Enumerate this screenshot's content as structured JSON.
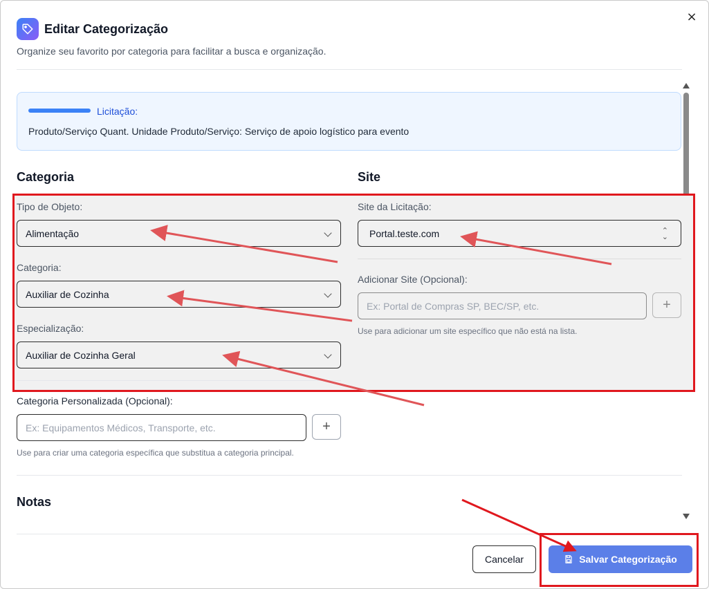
{
  "dialog": {
    "title": "Editar Categorização",
    "subtitle": "Organize seu favorito por categoria para facilitar a busca e organização.",
    "close_glyph": "×"
  },
  "info": {
    "label": "Licitação:",
    "text": "Produto/Serviço Quant. Unidade Produto/Serviço: Serviço de apoio logístico para evento"
  },
  "categoria": {
    "heading": "Categoria",
    "tipo_label": "Tipo de Objeto:",
    "tipo_value": "Alimentação",
    "categoria_label": "Categoria:",
    "categoria_value": "Auxiliar de Cozinha",
    "especializacao_label": "Especialização:",
    "especializacao_value": "Auxiliar de Cozinha Geral",
    "personalizada_label": "Categoria Personalizada (Opcional):",
    "personalizada_placeholder": "Ex: Equipamentos Médicos, Transporte, etc.",
    "personalizada_hint": "Use para criar uma categoria específica que substitua a categoria principal.",
    "plus_glyph": "+"
  },
  "site": {
    "heading": "Site",
    "site_label": "Site da Licitação:",
    "site_value": "Portal.teste.com",
    "adicionar_label": "Adicionar Site (Opcional):",
    "adicionar_placeholder": "Ex: Portal de Compras SP, BEC/SP, etc.",
    "adicionar_hint": "Use para adicionar um site específico que não está na lista.",
    "plus_glyph": "+"
  },
  "notas": {
    "heading": "Notas"
  },
  "footer": {
    "cancel_label": "Cancelar",
    "save_label": "Salvar Categorização"
  },
  "icons": {
    "title": "tag-icon",
    "save": "save-icon",
    "close": "close-icon",
    "chevron": "chevron-down-icon",
    "updown": "chevron-up-down-icon"
  },
  "colors": {
    "accent": "#5b7fe8",
    "annotation": "#e0181e",
    "info_bg": "#eff6ff"
  }
}
